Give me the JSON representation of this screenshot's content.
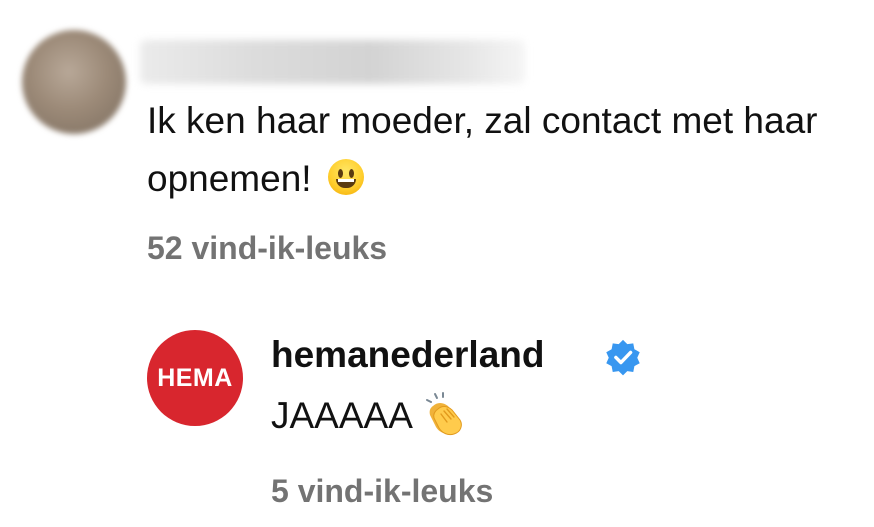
{
  "comment": {
    "text": "Ik ken haar moeder, zal contact met haar opnemen!",
    "emoji": "smiling-face-icon",
    "likes_label": "52 vind-ik-leuks"
  },
  "reply": {
    "username": "hemanederland",
    "avatar_text": "HEMA",
    "verified_icon": "verified-badge-icon",
    "text": "JAAAAA",
    "emoji": "clapping-hands-icon",
    "likes_label": "5 vind-ik-leuks"
  },
  "colors": {
    "text": "#111111",
    "muted": "#737373",
    "hema_red": "#d8262e",
    "verified_blue": "#3897f0"
  }
}
